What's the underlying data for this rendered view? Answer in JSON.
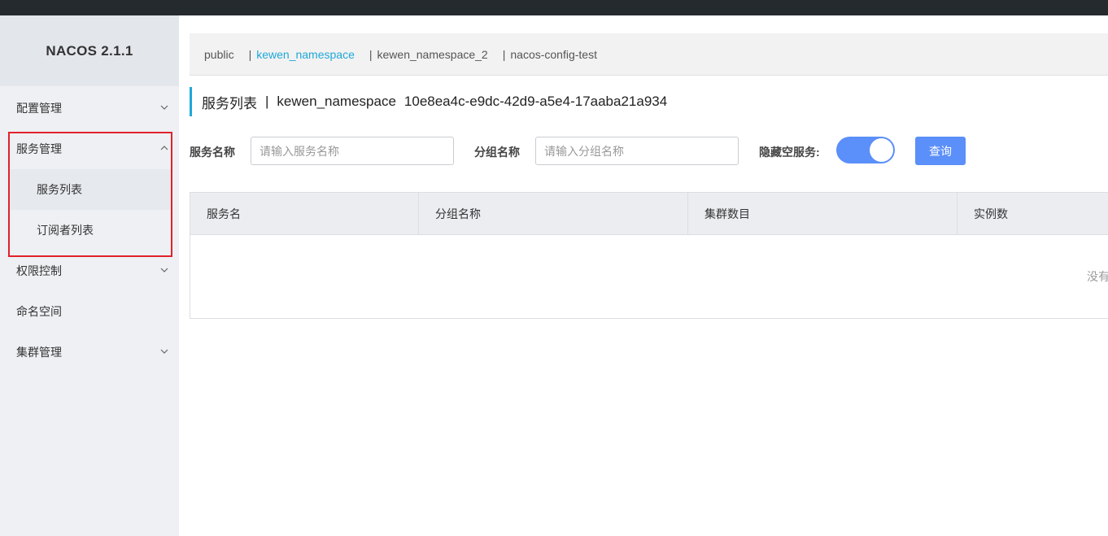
{
  "app": {
    "brand": "NACOS 2.1.1"
  },
  "sidebar": {
    "menu": [
      {
        "label": "配置管理",
        "expanded": false
      },
      {
        "label": "服务管理",
        "expanded": true,
        "children": [
          {
            "label": "服务列表",
            "active": true
          },
          {
            "label": "订阅者列表",
            "active": false
          }
        ]
      },
      {
        "label": "权限控制",
        "expanded": false
      },
      {
        "label": "命名空间"
      },
      {
        "label": "集群管理",
        "expanded": false
      }
    ]
  },
  "namespaces": {
    "items": [
      "public",
      "kewen_namespace",
      "kewen_namespace_2",
      "nacos-config-test"
    ],
    "separator": "|",
    "active": "kewen_namespace"
  },
  "page": {
    "title": "服务列表",
    "separator": "|",
    "namespace_name": "kewen_namespace",
    "namespace_id": "10e8ea4c-e9dc-42d9-a5e4-17aaba21a934"
  },
  "filters": {
    "service_name_label": "服务名称",
    "service_name_placeholder": "请输入服务名称",
    "group_name_label": "分组名称",
    "group_name_placeholder": "请输入分组名称",
    "hide_empty_label": "隐藏空服务:",
    "hide_empty_on": true,
    "query_label": "查询"
  },
  "table": {
    "columns": [
      "服务名",
      "分组名称",
      "集群数目",
      "实例数"
    ],
    "empty_text": "没有数据"
  },
  "colors": {
    "accent": "#1fa8d9",
    "primary": "#5b8ff9",
    "highlight": "#e0222b"
  }
}
